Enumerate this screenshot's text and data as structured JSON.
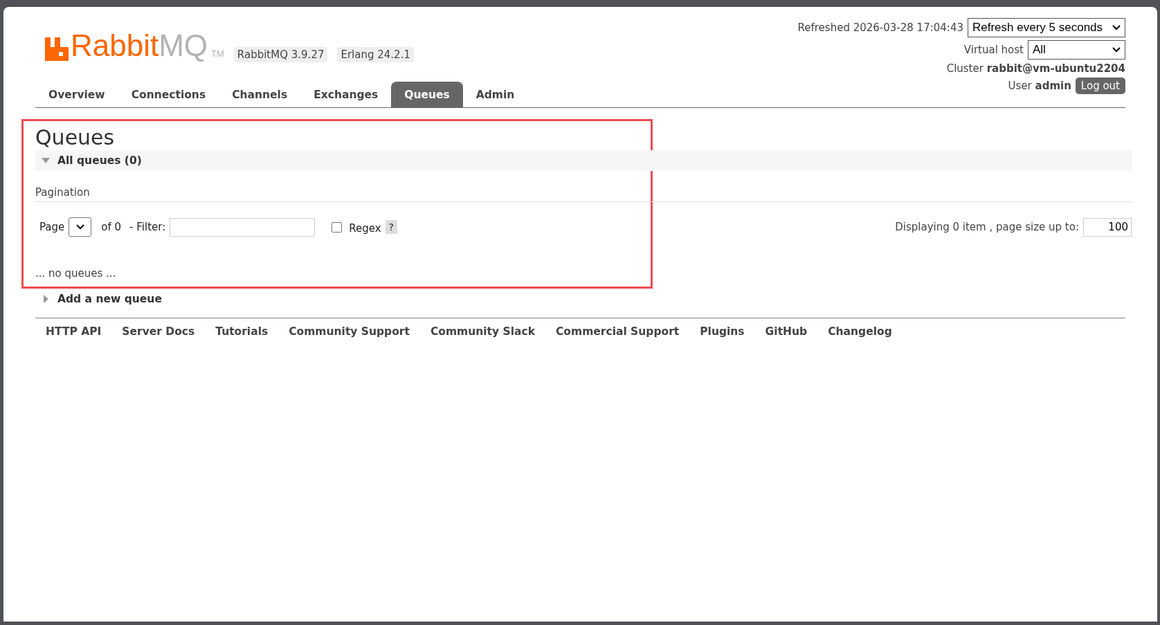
{
  "logo": {
    "brand": "Rabbit",
    "suffix": "MQ",
    "tm": "TM"
  },
  "versions": [
    "RabbitMQ 3.9.27",
    "Erlang 24.2.1"
  ],
  "header": {
    "refreshed": "Refreshed 2026-03-28 17:04:43",
    "refresh_select": "Refresh every 5 seconds",
    "vhost_label": "Virtual host",
    "vhost_select": "All",
    "cluster_label": "Cluster",
    "cluster_name": "rabbit@vm-ubuntu2204",
    "user_label": "User",
    "user_name": "admin",
    "logout": "Log out"
  },
  "tabs": [
    {
      "label": "Overview",
      "selected": false
    },
    {
      "label": "Connections",
      "selected": false
    },
    {
      "label": "Channels",
      "selected": false
    },
    {
      "label": "Exchanges",
      "selected": false
    },
    {
      "label": "Queues",
      "selected": true
    },
    {
      "label": "Admin",
      "selected": false
    }
  ],
  "highlight_frame": {
    "shown": true
  },
  "page_title": "Queues",
  "all_queues": {
    "label": "All queues (0)",
    "expanded": true
  },
  "pagination": {
    "heading": "Pagination",
    "page_label": "Page",
    "of_label": "of 0",
    "filter_label": "- Filter:",
    "regex": {
      "label": "Regex",
      "checked": false
    },
    "help": "?",
    "displaying": "Displaying 0 item , page size up to:",
    "page_size": "100"
  },
  "empty_text": "... no queues ...",
  "add_queue": {
    "label": "Add a new queue",
    "expanded": false
  },
  "footer_links": [
    "HTTP API",
    "Server Docs",
    "Tutorials",
    "Community Support",
    "Community Slack",
    "Commercial Support",
    "Plugins",
    "GitHub",
    "Changelog"
  ]
}
